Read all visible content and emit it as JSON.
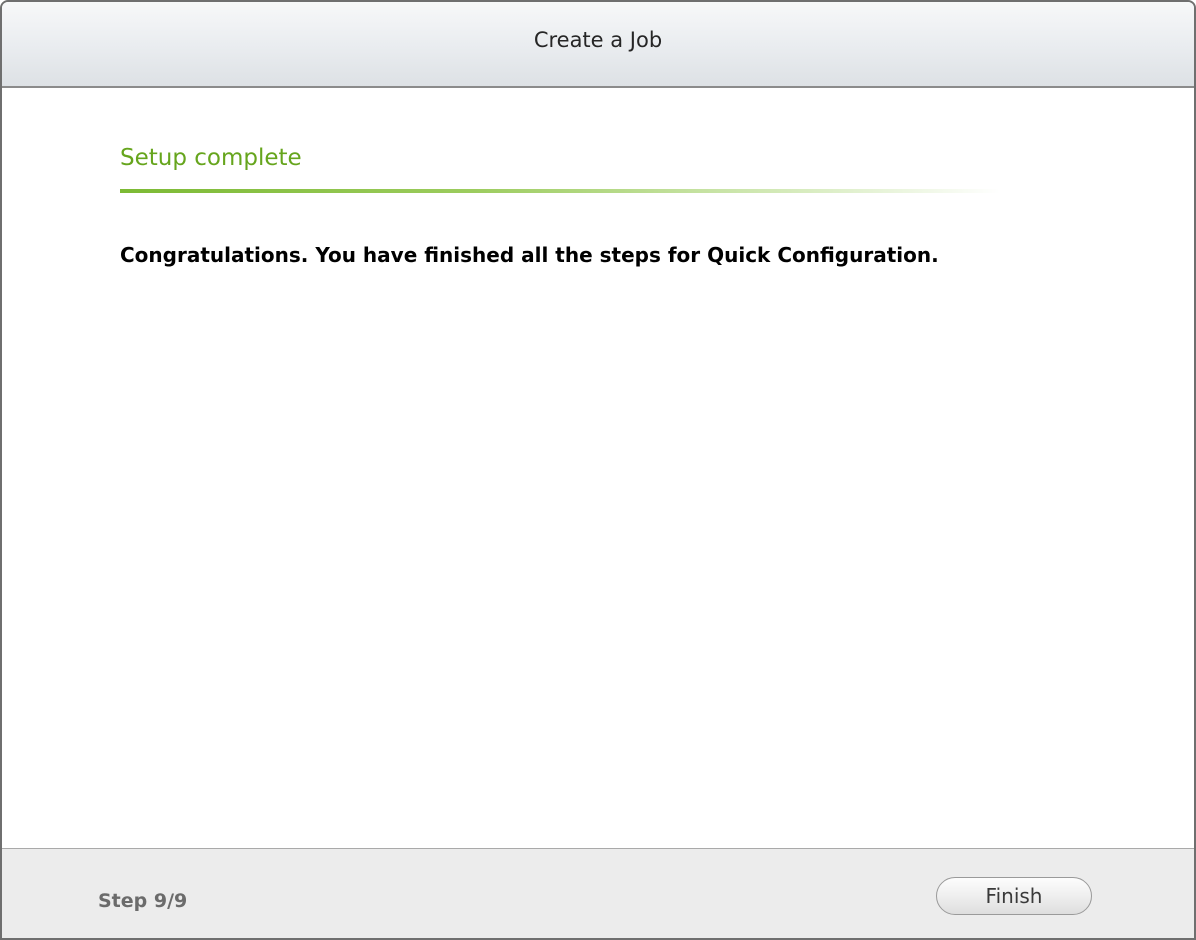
{
  "dialog": {
    "title": "Create a Job"
  },
  "section": {
    "title": "Setup complete",
    "message": "Congratulations. You have finished all the steps for Quick Configuration."
  },
  "footer": {
    "step_label": "Step 9/9",
    "finish_label": "Finish"
  },
  "colors": {
    "accent_green": "#66a51d",
    "titlebar": "#e9ecef",
    "footer": "#ececec"
  }
}
